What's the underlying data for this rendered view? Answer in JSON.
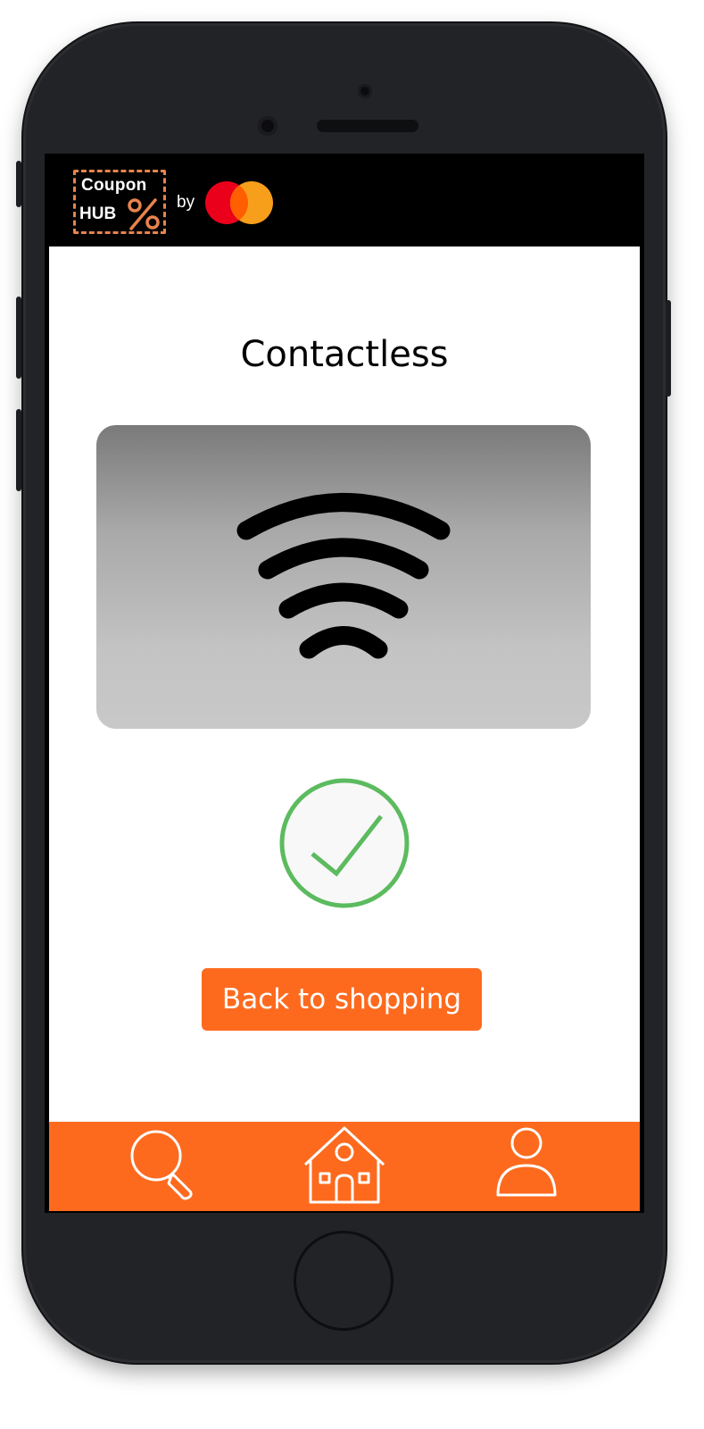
{
  "app": {
    "logo_top_text": "Coupon",
    "logo_bottom_text": "HUB",
    "logo_by": "by",
    "partner_brand_icon": "mastercard-logo-icon"
  },
  "page": {
    "title": "Contactless",
    "nfc_icon": "contactless-waves-icon",
    "status_icon": "success-check-icon",
    "back_button_label": "Back to shopping"
  },
  "bottom_nav": {
    "items": [
      {
        "icon": "search-icon"
      },
      {
        "icon": "home-icon"
      },
      {
        "icon": "profile-icon"
      }
    ]
  },
  "colors": {
    "accent": "#fd6a1e",
    "logo_border": "#e8834d",
    "success": "#5cbb5f",
    "mastercard_red": "#eb001b",
    "mastercard_orange": "#f79e1b"
  }
}
